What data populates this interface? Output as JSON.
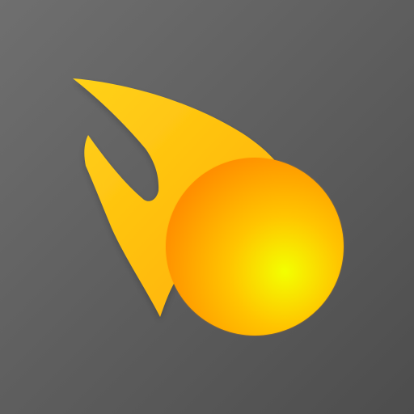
{
  "icon": {
    "name": "comet-icon",
    "colors": {
      "background_light": "#6f6f6f",
      "background_dark": "#4d4d4d",
      "tail_light": "#ffd21a",
      "tail_dark": "#ffad00",
      "ball_center": "#f3ff00",
      "ball_mid": "#ffc400",
      "ball_edge": "#ff8f00"
    }
  }
}
